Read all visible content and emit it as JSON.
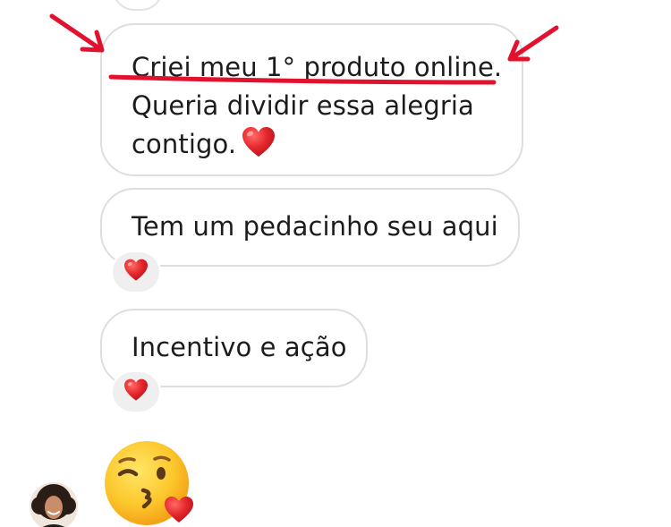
{
  "thread": {
    "messages": [
      {
        "lines": [
          "Criei meu 1° produto online.",
          "Queria dividir essa alegria",
          "contigo."
        ],
        "inline_emoji": "red-heart"
      },
      {
        "text": "Tem um pedacinho seu aqui",
        "reaction": "red-heart"
      },
      {
        "text": "Incentivo e ação",
        "reaction": "red-heart"
      }
    ],
    "sticker": "face-blowing-a-kiss",
    "avatar": "profile-photo"
  },
  "colors": {
    "bubble_border": "#dedede",
    "text": "#1c1c1e",
    "heart": "#e0282e",
    "annotation": "#e2112e",
    "reaction_bg": "#efefef"
  }
}
